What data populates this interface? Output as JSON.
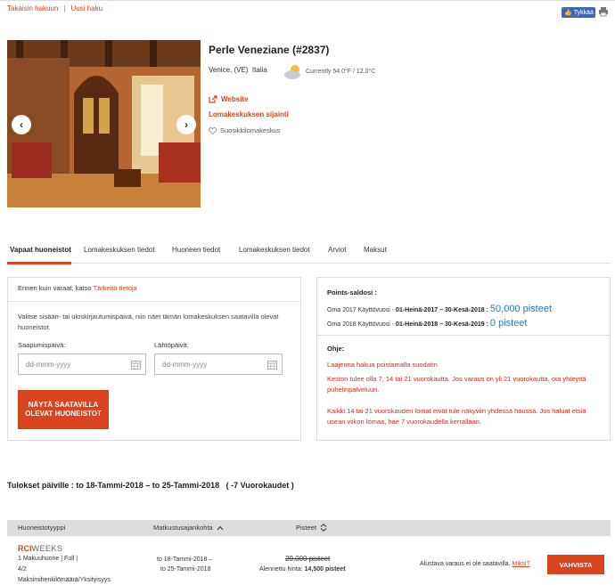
{
  "toplinks": {
    "back": "Takaisin hakuun",
    "new_search": "Uusi haku"
  },
  "share": {
    "facebook_label": "Tykkää"
  },
  "resort": {
    "title": "Perle Veneziane (#2837)",
    "city": "Venice, (VE)",
    "country": "Italia",
    "weather": "Currently 54.0°F / 12.0°C",
    "website_label": "Website",
    "location_label": "Lomakeskuksen sijainti",
    "favorite_label": "Suosikkilomakeskus"
  },
  "tabs": [
    {
      "label": "Vapaat huoneistot"
    },
    {
      "label": "Lomakeskuksen tiedot"
    },
    {
      "label": "Huoneen tiedot"
    },
    {
      "label": "Lomakeskuksen tiedot"
    },
    {
      "label": "Arviot"
    },
    {
      "label": "Maksut"
    }
  ],
  "booking": {
    "note_prefix": "Ennen kuin varaat, katso",
    "note_link": "Tärkeitä tietoja",
    "instructions": "Valitse sisään- tai uloskirjautumispäivä, niin näet tämän lomakeskuksen saatavilla olevat huoneistot.",
    "arrival_label": "Saapumispäivä:",
    "departure_label": "Lähtöpäivä:",
    "arrival_placeholder": "dd-mmm-yyyy",
    "departure_placeholder": "dd-mmm-yyyy",
    "show_button": "NÄYTÄ SAATAVILLA OLEVAT HUONEISTOT"
  },
  "points": {
    "title": "Points-saldosi :",
    "rows": [
      {
        "label": "Oma 2017 Käyttövuosi -",
        "range": "01-Heinä-2017 – 30-Kesä-2018 :",
        "value": "50,000 pisteet"
      },
      {
        "label": "Oma 2018 Käyttövuosi -",
        "range": "01-Heinä-2018 – 30-Kesä-2019 :",
        "value": "0 pisteet"
      }
    ],
    "help_title": "Ohje:",
    "help_1": "Laajenna hakua poistamalla suodatin",
    "help_2": "Keston tulee olla 7, 14 tai 21 vuorokautta. Jos varaus on yli 21 vuorokautta, ota yhteyttä puhelinpalveluun.",
    "help_3": "Kaikki 14 tai 21 vuorokauden lomat eivät tule näkyviin yhdessä haussa. Jos haluat etsiä usean viikon lomaa, hae 7 vuorokaudella kerrallaan."
  },
  "results": {
    "title": "Tulokset päiville : to 18-Tammi-2018 – to 25-Tammi-2018",
    "nights": "( -7 Vuorokaudet )",
    "columns": {
      "type": "Huoneistotyyppi",
      "dates": "Matkustusajankohta",
      "points": "Pisteet"
    },
    "row": {
      "brand_rci": "RCI",
      "brand_weeks": "WEEKS",
      "unit": "1 Makuuhuone",
      "kitchen": "Full",
      "occupancy": "4/2",
      "occupancy_label": "Maksimihenkilömäärä/Yksityisyys",
      "date_from": "to 18-Tammi-2018 –",
      "date_to": "to 25-Tammi-2018",
      "original_points": "29,000 pisteet",
      "discount_label": "Alennettu hinta:",
      "discount_points": "14,500 pisteet",
      "availability": "Alustava varaus ei ole saatavilla.",
      "why_link": "Miksi?",
      "confirm_button": "VAHVISTA"
    }
  }
}
